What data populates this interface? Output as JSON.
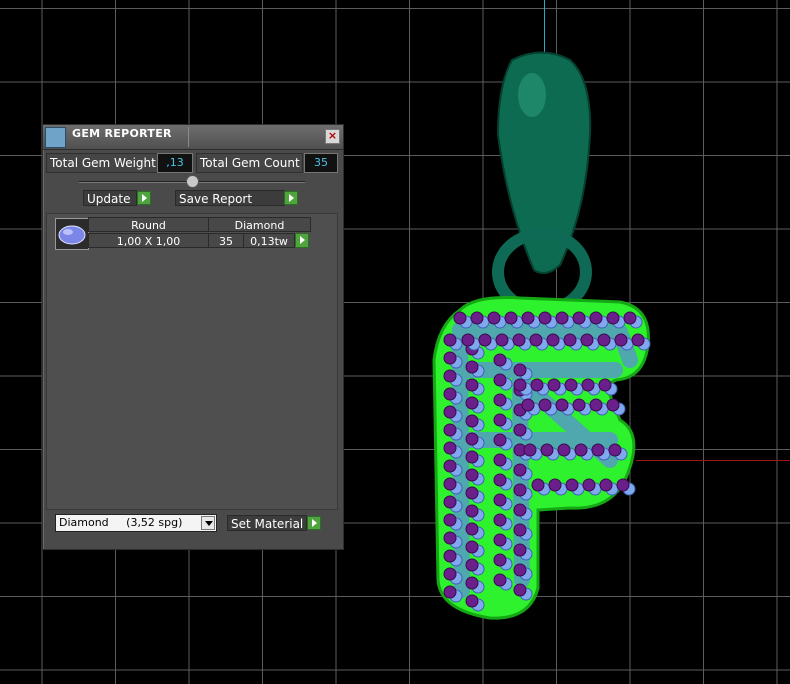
{
  "panel": {
    "title": "GEM REPORTER",
    "close_symbol": "×",
    "stats": {
      "weight_label": "Total Gem Weight",
      "weight_value": ",13",
      "count_label": "Total Gem Count",
      "count_value": "35"
    },
    "buttons": {
      "update": "Update",
      "save_report": "Save Report",
      "set_material": "Set Material"
    },
    "report": {
      "headers": [
        "Round",
        "Diamond"
      ],
      "rows": [
        {
          "size": "1,00 X 1,00",
          "count": "35",
          "weight": "0,13tw"
        }
      ]
    },
    "material_select": {
      "selected": "Diamond     (3,52 spg)"
    }
  },
  "icons": {
    "panel": "gem-reporter-icon",
    "close": "close-icon",
    "arrow": "green-arrow-icon",
    "gem": "round-gem-icon",
    "dropdown": "chevron-down-icon"
  },
  "colors": {
    "viewport_bg": "#000000",
    "grid": "#5c5c5c",
    "panel_bg": "#4a4a4a",
    "value_text": "#49c4e6",
    "button_accent": "#4fa43d",
    "metal": "#0d6b52",
    "rim": "#2df22d",
    "stone_purple": "#6a1f8a",
    "stone_blue": "#7fa8ef"
  }
}
